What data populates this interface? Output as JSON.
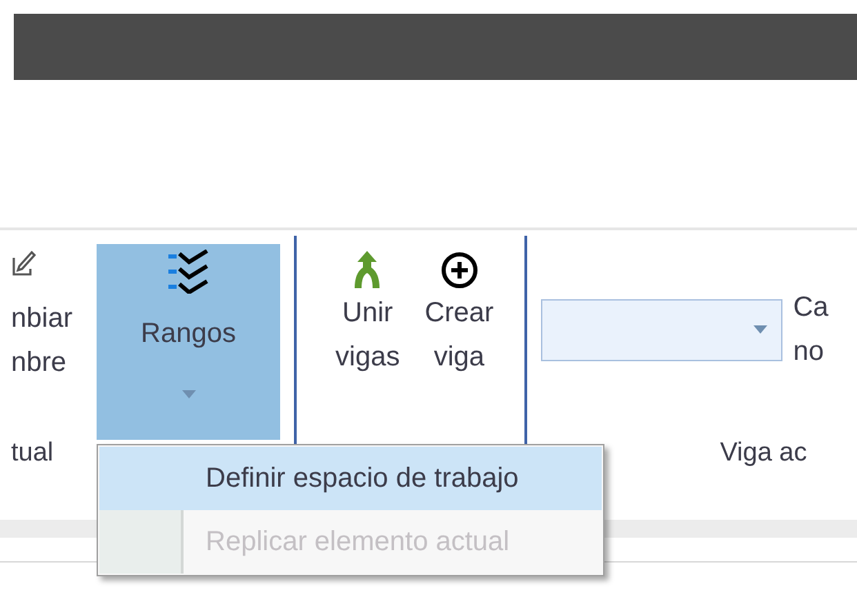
{
  "left_group": {
    "label": "tual",
    "button": {
      "lines": [
        "nbiar",
        "nbre"
      ]
    }
  },
  "rangos_button": {
    "label": "Rangos",
    "pressed": true
  },
  "beam_buttons": [
    {
      "lines": [
        "Unir",
        "vigas"
      ],
      "kind": "join"
    },
    {
      "lines": [
        "Crear",
        "viga"
      ],
      "kind": "create"
    }
  ],
  "beam_group": {
    "label": "Viga ac",
    "side_button": {
      "lines": [
        "Ca",
        "no"
      ]
    }
  },
  "menu": {
    "items": [
      {
        "label": "Definir espacio de trabajo",
        "selected": true,
        "disabled": false
      },
      {
        "label": "Replicar elemento actual",
        "selected": false,
        "disabled": true
      }
    ]
  }
}
